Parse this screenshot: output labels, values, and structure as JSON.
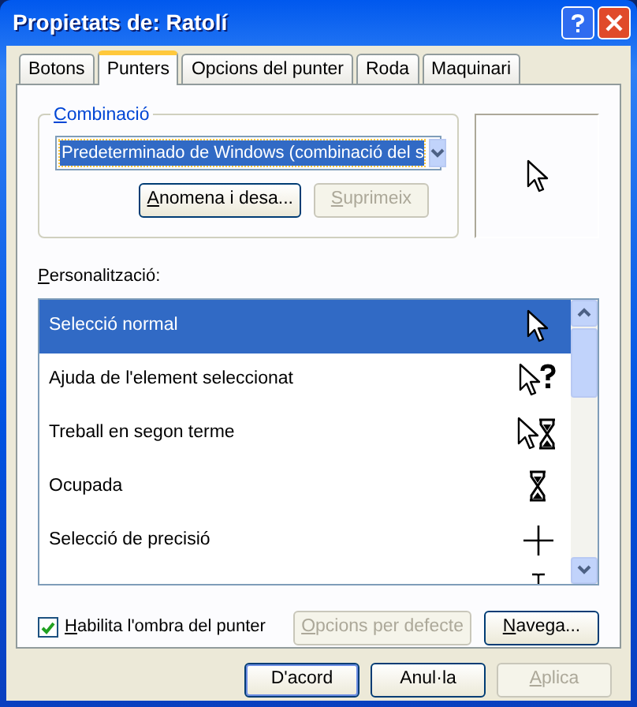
{
  "window": {
    "title": "Propietats de: Ratolí"
  },
  "tabs": [
    {
      "label": "Botons",
      "selected": false
    },
    {
      "label": "Punters",
      "selected": true
    },
    {
      "label": "Opcions del punter",
      "selected": false
    },
    {
      "label": "Roda",
      "selected": false
    },
    {
      "label": "Maquinari",
      "selected": false
    }
  ],
  "scheme": {
    "label": "Combinació",
    "value": "Predeterminado de Windows (combinació del s",
    "buttons": [
      {
        "label": "Anomena i desa...",
        "disabled": false
      },
      {
        "label": "Suprimeix",
        "disabled": true
      }
    ]
  },
  "customize": {
    "label": "Personalització:",
    "items": [
      {
        "label": "Selecció normal",
        "kind": "normal",
        "selected": true
      },
      {
        "label": "Ajuda de l'element seleccionat",
        "kind": "help",
        "selected": false
      },
      {
        "label": "Treball en segon terme",
        "kind": "working",
        "selected": false
      },
      {
        "label": "Ocupada",
        "kind": "busy",
        "selected": false
      },
      {
        "label": "Selecció de precisió",
        "kind": "precision",
        "selected": false
      },
      {
        "kind": "text",
        "selected": false
      }
    ]
  },
  "shadow": {
    "label": "Habilita l'ombra del punter",
    "checked": true
  },
  "panel_buttons": [
    {
      "label": "Opcions per defecte",
      "disabled": true
    },
    {
      "label": "Navega...",
      "disabled": false
    }
  ],
  "buttons": [
    {
      "label": "D'acord",
      "disabled": false,
      "default": true
    },
    {
      "label": "Anul·la",
      "disabled": false,
      "default": false
    },
    {
      "label": "Aplica",
      "disabled": true,
      "default": false
    }
  ]
}
